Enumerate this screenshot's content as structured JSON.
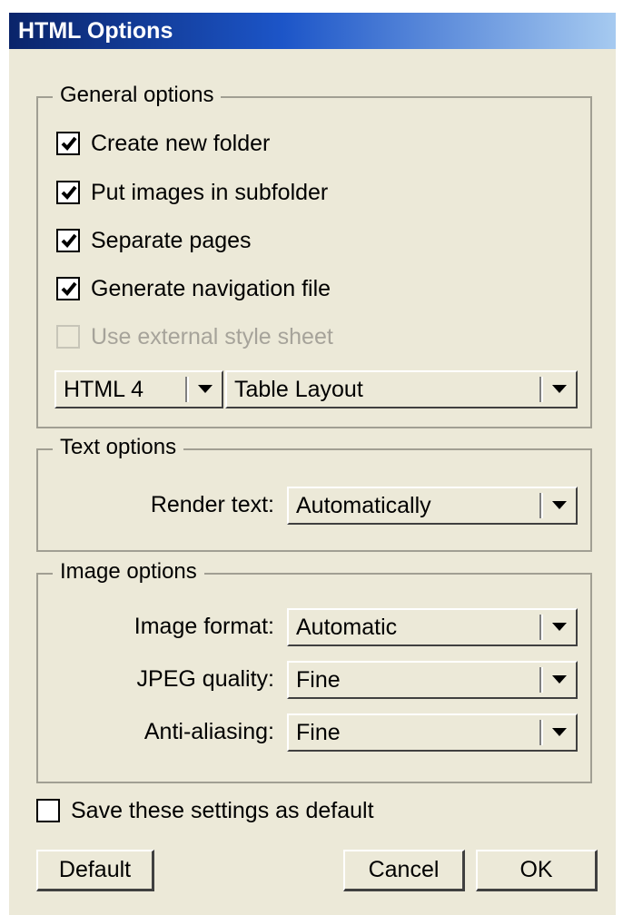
{
  "window": {
    "title": "HTML Options"
  },
  "general": {
    "legend": "General options",
    "checkboxes": [
      {
        "label": "Create new folder",
        "checked": true,
        "enabled": true
      },
      {
        "label": "Put images in subfolder",
        "checked": true,
        "enabled": true
      },
      {
        "label": "Separate pages",
        "checked": true,
        "enabled": true
      },
      {
        "label": "Generate navigation file",
        "checked": true,
        "enabled": true
      },
      {
        "label": "Use external style sheet",
        "checked": false,
        "enabled": false
      }
    ],
    "html_version": "HTML 4",
    "layout": "Table Layout"
  },
  "text": {
    "legend": "Text options",
    "render_label": "Render text:",
    "render_value": "Automatically"
  },
  "image": {
    "legend": "Image options",
    "format_label": "Image format:",
    "format_value": "Automatic",
    "quality_label": "JPEG quality:",
    "quality_value": "Fine",
    "aa_label": "Anti-aliasing:",
    "aa_value": "Fine"
  },
  "save_default": {
    "label": "Save these settings as default",
    "checked": false
  },
  "buttons": {
    "default": "Default",
    "cancel": "Cancel",
    "ok": "OK"
  },
  "colors": {
    "face": "#ece9d8",
    "title_start": "#0a246a",
    "title_end": "#a6caf0"
  }
}
